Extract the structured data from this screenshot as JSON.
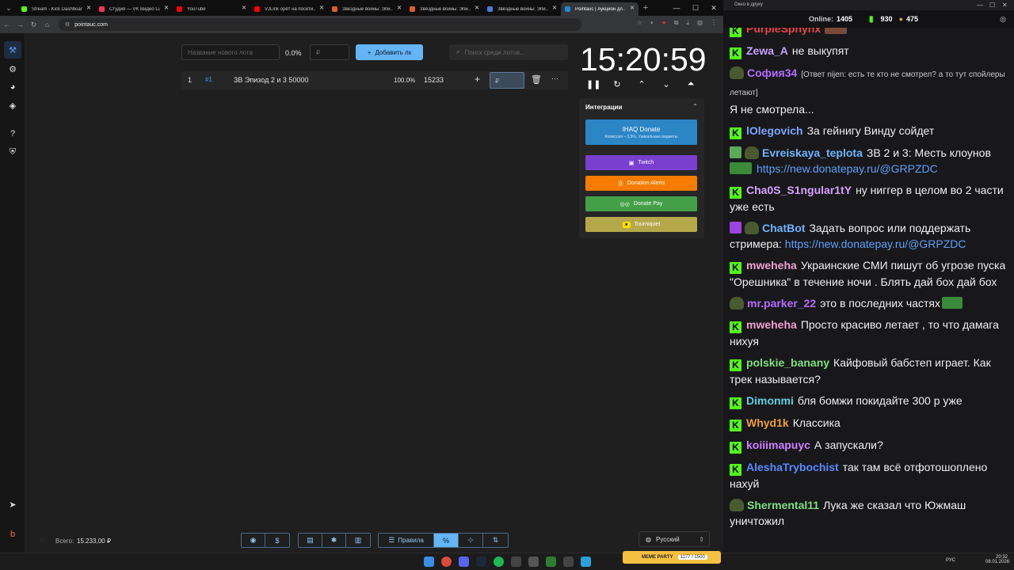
{
  "browser": {
    "tabs": [
      {
        "label": "Stream - Kick Dashboard",
        "fav": "#53fc18"
      },
      {
        "label": "Студия — VK Видео Li...",
        "fav": "#ff3355"
      },
      {
        "label": "YouTube",
        "fav": "#ff0000"
      },
      {
        "label": "VJLink орёт на посети...",
        "fav": "#ff0000"
      },
      {
        "label": "Звёздные войны: Эпи...",
        "fav": "#e25d2c"
      },
      {
        "label": "Звёздные войны: Эпи...",
        "fav": "#e25d2c"
      },
      {
        "label": "Звёздные войны: Эпи...",
        "fav": "#4a7bd8"
      },
      {
        "label": "Pointauc | Аукцион дл...",
        "fav": "#1f8ad1",
        "active": true
      }
    ],
    "url": "pointauc.com"
  },
  "auction": {
    "new_lot_placeholder": "Название нового лота",
    "percent": "0.0%",
    "currency_placeholder": "₽",
    "add_button": "Добавить лк",
    "search_placeholder": "Поиск среди лотов...",
    "lots": [
      {
        "index": "1",
        "id": "#1",
        "name": "ЗВ Эпизод 2 и 3 50000",
        "percent": "100.0%",
        "amount": "15233",
        "input_placeholder": "₽"
      }
    ],
    "timer": "15:20:59",
    "integrations": {
      "title": "Интеграции",
      "ihaq": {
        "label": "IHAQ Donate",
        "sub": "Комиссия – 3,5%. Уникальные виджеты"
      },
      "twitch": "Twitch",
      "donationalerts": "Donation Alerts",
      "donatepay": "Donate Pay",
      "tourniquet": "Tourniquet"
    },
    "total_label": "Всего:",
    "total_value": "15.233,00 ₽",
    "rules_label": "Правила",
    "language": "Русский"
  },
  "chat": {
    "window_title": "Окно в друку",
    "online_label": "Online:",
    "online_count": "1405",
    "points1": "930",
    "points2": "475",
    "messages": [
      {
        "user": "PurpleSphynx",
        "color": "#e84545",
        "text": ""
      },
      {
        "user": "Zewa_A",
        "color": "#c9a0ff",
        "text": "не выкупят"
      },
      {
        "user": "София34",
        "color": "#b46cff",
        "text": "[Ответ nijen: есть те кто не смотрел? а то тут спойлеры летают]",
        "sub": "Я не смотрела..."
      },
      {
        "user": "lOlegovich",
        "color": "#7aa8ff",
        "text": "За гейнигу Винду сойдет"
      },
      {
        "user": "Evreiskaya_teplota",
        "color": "#6fb4ff",
        "text": "ЗВ 2 и 3: Месть клоунов",
        "link": "https://new.donatepay.ru/@GRPZDC"
      },
      {
        "user": "Cha0S_S1ngular1tY",
        "color": "#d9a0ff",
        "text": "ну ниггер в целом во 2 части уже есть"
      },
      {
        "user": "ChatBot",
        "color": "#6fb4ff",
        "text": "Задать вопрос или поддержать стримера:",
        "link": "https://new.donatepay.ru/@GRPZDC"
      },
      {
        "user": "mweheha",
        "color": "#f0a0d0",
        "text": "Украинские СМИ пишут об угрозе пуска \"Орешника\" в течение ночи . Блять дай бох дай бох"
      },
      {
        "user": "mr.parker_22",
        "color": "#b46cff",
        "text": "это в последних частях"
      },
      {
        "user": "mweheha",
        "color": "#f0a0d0",
        "text": "Просто красиво летает , то что дамага нихуя"
      },
      {
        "user": "polskie_banany",
        "color": "#7ee07e",
        "text": "Кайфовый бабстеп играет. Как трек называется?"
      },
      {
        "user": "Dimonmi",
        "color": "#5fd0e0",
        "text": "бля бомжи покидайте 300 р уже"
      },
      {
        "user": "Whyd1k",
        "color": "#f0a030",
        "text": "Классика"
      },
      {
        "user": "koiiimapuyc",
        "color": "#d080ff",
        "text": "А запускали?"
      },
      {
        "user": "AleshaTrybochist",
        "color": "#5a8aff",
        "text": "так там всё отфотошоплено нахуй"
      },
      {
        "user": "Shermental11",
        "color": "#7ee07e",
        "text": "Лука же сказал что Южмаш уничтожил"
      }
    ]
  },
  "taskbar": {
    "lang": "РУС",
    "time": "20:32",
    "date": "08.01.2026",
    "meme": "MEME PARTY",
    "meme_counter": "1177 / 1500"
  }
}
